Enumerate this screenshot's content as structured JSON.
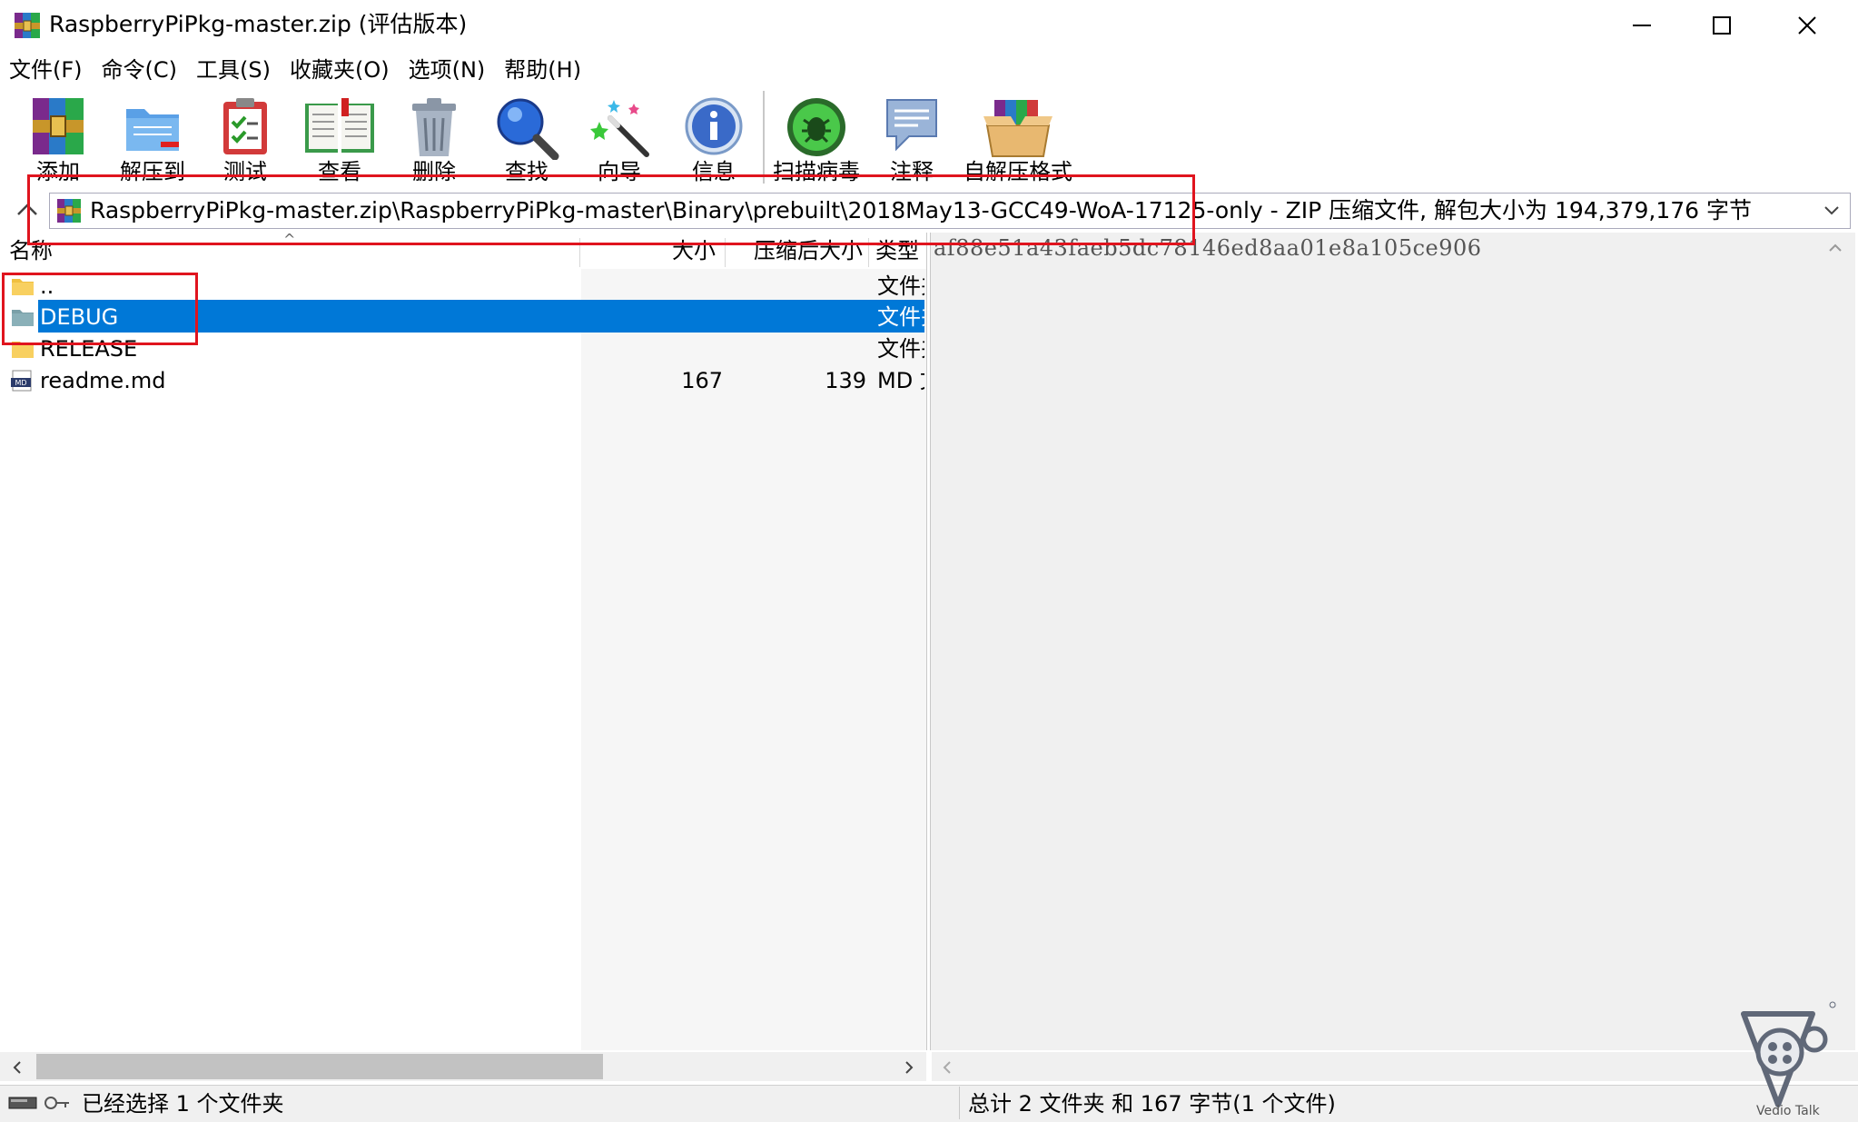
{
  "window": {
    "title": "RaspberryPiPkg-master.zip (评估版本)"
  },
  "menu": [
    "文件(F)",
    "命令(C)",
    "工具(S)",
    "收藏夹(O)",
    "选项(N)",
    "帮助(H)"
  ],
  "toolbar": {
    "add": "添加",
    "extract_to": "解压到",
    "test": "测试",
    "view": "查看",
    "delete": "删除",
    "find": "查找",
    "wizard": "向导",
    "info": "信息",
    "scan_virus": "扫描病毒",
    "comment": "注释",
    "sfx": "自解压格式"
  },
  "address": {
    "path": "RaspberryPiPkg-master.zip\\RaspberryPiPkg-master\\Binary\\prebuilt\\2018May13-GCC49-WoA-17125-only - ZIP 压缩文件, 解包大小为 194,379,176 字节"
  },
  "columns": {
    "name": "名称",
    "size": "大小",
    "packed": "压缩后大小",
    "type": "类型"
  },
  "files": [
    {
      "name": "..",
      "size": "",
      "packed": "",
      "type": "文件夹"
    },
    {
      "name": "DEBUG",
      "size": "",
      "packed": "",
      "type": "文件夹"
    },
    {
      "name": "RELEASE",
      "size": "",
      "packed": "",
      "type": "文件夹"
    },
    {
      "name": "readme.md",
      "size": "167",
      "packed": "139",
      "type": "MD 文件",
      "icon_text": "MD"
    }
  ],
  "preview": {
    "text": "af88e51a43faeb5dc78146ed8aa01e8a105ce906"
  },
  "status": {
    "left": "已经选择 1 个文件夹",
    "right": "总计 2 文件夹 和 167 字节(1 个文件)"
  },
  "watermark": {
    "text": "Vedio Talk"
  },
  "colors": {
    "selection": "#0078d7",
    "highlight_box": "#e0141e"
  }
}
